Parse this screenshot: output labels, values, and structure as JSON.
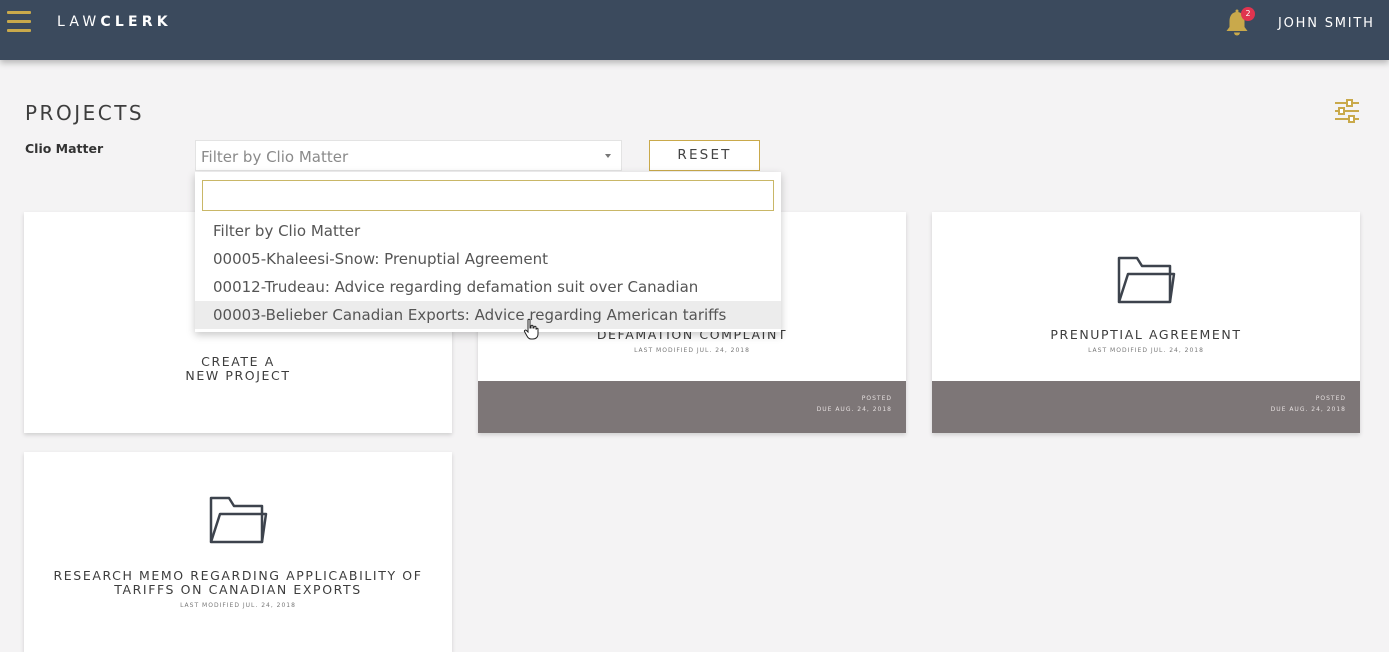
{
  "header": {
    "brand_light": "LAW",
    "brand_bold": "CLERK",
    "notification_count": "2",
    "user_name": "JOHN SMITH"
  },
  "page": {
    "title": "PROJECTS",
    "filter_label": "Clio Matter",
    "filter_placeholder": "Filter by Clio Matter",
    "reset_label": "RESET"
  },
  "dropdown": {
    "search_value": "",
    "options": [
      "Filter by Clio Matter",
      "00005-Khaleesi-Snow: Prenuptial Agreement",
      "00012-Trudeau: Advice regarding defamation suit over Canadian",
      "00003-Belieber Canadian Exports: Advice regarding American tariffs"
    ],
    "highlighted_index": 3
  },
  "cards": {
    "create": {
      "line1": "CREATE A",
      "line2": "NEW PROJECT"
    },
    "defamation": {
      "title": "DEFAMATION COMPLAINT",
      "modified": "LAST MODIFIED JUL. 24, 2018",
      "status": "POSTED",
      "due": "DUE AUG. 24, 2018"
    },
    "prenup": {
      "title": "PRENUPTIAL AGREEMENT",
      "modified": "LAST MODIFIED JUL. 24, 2018",
      "status": "POSTED",
      "due": "DUE AUG. 24, 2018"
    },
    "research": {
      "title_line1": "RESEARCH MEMO REGARDING APPLICABILITY OF",
      "title_line2": "TARIFFS ON CANADIAN EXPORTS",
      "modified": "LAST MODIFIED JUL. 24, 2018"
    }
  },
  "colors": {
    "topbar": "#3b4a5d",
    "accent_gold": "#c9a94b",
    "card_footer": "#7d7677",
    "badge": "#e0344f"
  },
  "icons": [
    "menu-icon",
    "bell-icon",
    "filter-settings-icon",
    "folder-icon",
    "pointer-cursor-icon"
  ]
}
